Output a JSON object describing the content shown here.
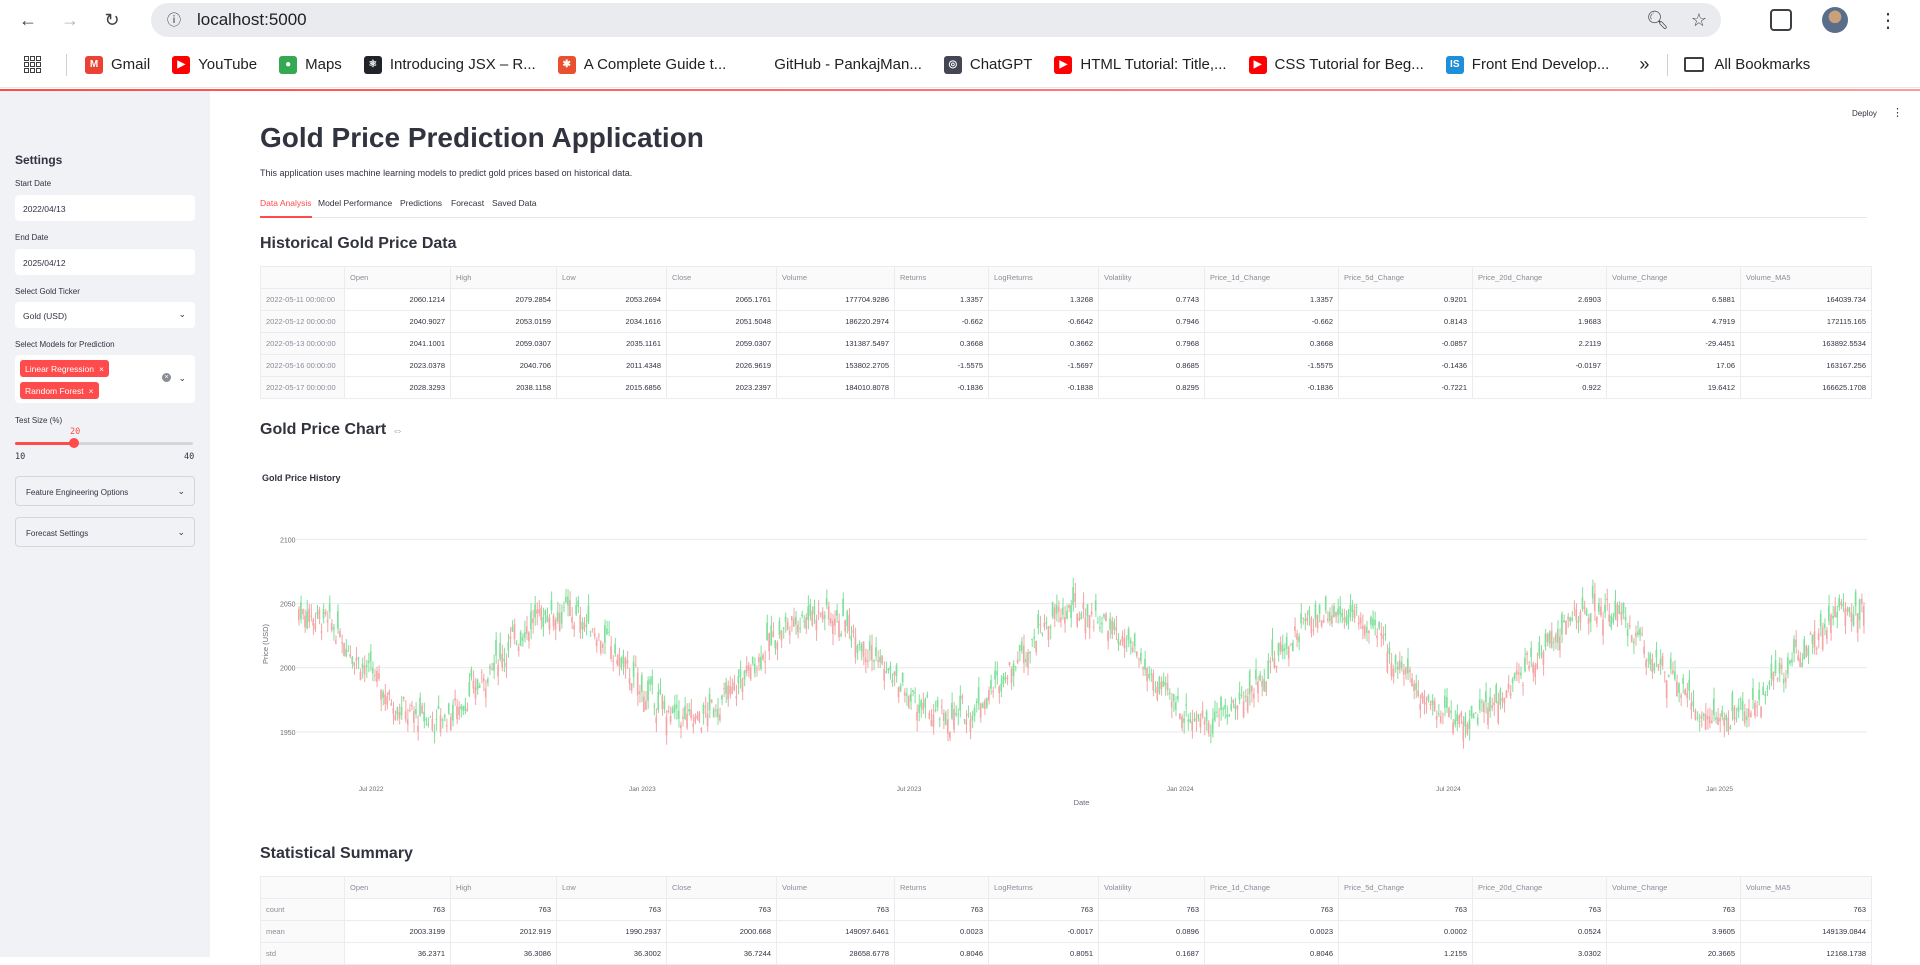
{
  "browser": {
    "url": "localhost:5000",
    "bookmarks": [
      {
        "label": "Gmail",
        "color": "#ea4335",
        "glyph": "M"
      },
      {
        "label": "YouTube",
        "color": "#ff0000",
        "glyph": "▶"
      },
      {
        "label": "Maps",
        "color": "#34a853",
        "glyph": "●"
      },
      {
        "label": "Introducing JSX – R...",
        "color": "#20232a",
        "glyph": "⚛"
      },
      {
        "label": "A Complete Guide t...",
        "color": "#e8502f",
        "glyph": "✱"
      },
      {
        "label": "GitHub - PankajMan...",
        "color": "#ffffff",
        "glyph": ""
      },
      {
        "label": "ChatGPT",
        "color": "#444654",
        "glyph": "◎"
      },
      {
        "label": "HTML Tutorial: Title,...",
        "color": "#ff0000",
        "glyph": "▶"
      },
      {
        "label": "CSS Tutorial for Beg...",
        "color": "#ff0000",
        "glyph": "▶"
      },
      {
        "label": "Front End Develop...",
        "color": "#1e8fd8",
        "glyph": "IS"
      }
    ],
    "all_bookmarks": "All Bookmarks"
  },
  "sidebar": {
    "title": "Settings",
    "start_date_label": "Start Date",
    "start_date": "2022/04/13",
    "end_date_label": "End Date",
    "end_date": "2025/04/12",
    "ticker_label": "Select Gold Ticker",
    "ticker": "Gold (USD)",
    "models_label": "Select Models for Prediction",
    "models": [
      "Linear Regression",
      "Random Forest"
    ],
    "test_size_label": "Test Size (%)",
    "test_size": "20",
    "test_size_min": "10",
    "test_size_max": "40",
    "test_size_fraction": 0.33,
    "expanders": [
      "Feature Engineering Options",
      "Forecast Settings"
    ]
  },
  "header": {
    "deploy": "Deploy"
  },
  "main": {
    "title": "Gold Price Prediction Application",
    "description": "This application uses machine learning models to predict gold prices based on historical data.",
    "tabs": [
      "Data Analysis",
      "Model Performance",
      "Predictions",
      "Forecast",
      "Saved Data"
    ],
    "historical_heading": "Historical Gold Price Data",
    "chart_heading": "Gold Price Chart",
    "stats_heading": "Statistical Summary"
  },
  "historical_table": {
    "columns": [
      "",
      "Open",
      "High",
      "Low",
      "Close",
      "Volume",
      "Returns",
      "LogReturns",
      "Volatility",
      "Price_1d_Change",
      "Price_5d_Change",
      "Price_20d_Change",
      "Volume_Change",
      "Volume_MA5"
    ],
    "rows": [
      [
        "2022-05-11 00:00:00",
        "2060.1214",
        "2079.2854",
        "2053.2694",
        "2065.1761",
        "177704.9286",
        "1.3357",
        "1.3268",
        "0.7743",
        "1.3357",
        "0.9201",
        "2.6903",
        "6.5881",
        "164039.734"
      ],
      [
        "2022-05-12 00:00:00",
        "2040.9027",
        "2053.0159",
        "2034.1616",
        "2051.5048",
        "186220.2974",
        "-0.662",
        "-0.6642",
        "0.7946",
        "-0.662",
        "0.8143",
        "1.9683",
        "4.7919",
        "172115.165"
      ],
      [
        "2022-05-13 00:00:00",
        "2041.1001",
        "2059.0307",
        "2035.1161",
        "2059.0307",
        "131387.5497",
        "0.3668",
        "0.3662",
        "0.7968",
        "0.3668",
        "-0.0857",
        "2.2119",
        "-29.4451",
        "163892.5534"
      ],
      [
        "2022-05-16 00:00:00",
        "2023.0378",
        "2040.706",
        "2011.4348",
        "2026.9619",
        "153802.2705",
        "-1.5575",
        "-1.5697",
        "0.8685",
        "-1.5575",
        "-0.1436",
        "-0.0197",
        "17.06",
        "163167.256"
      ],
      [
        "2022-05-17 00:00:00",
        "2028.3293",
        "2038.1158",
        "2015.6856",
        "2023.2397",
        "184010.8078",
        "-0.1836",
        "-0.1838",
        "0.8295",
        "-0.1836",
        "-0.7221",
        "0.922",
        "19.6412",
        "166625.1708"
      ]
    ]
  },
  "stats_table": {
    "columns": [
      "",
      "Open",
      "High",
      "Low",
      "Close",
      "Volume",
      "Returns",
      "LogReturns",
      "Volatility",
      "Price_1d_Change",
      "Price_5d_Change",
      "Price_20d_Change",
      "Volume_Change",
      "Volume_MA5"
    ],
    "rows": [
      [
        "count",
        "763",
        "763",
        "763",
        "763",
        "763",
        "763",
        "763",
        "763",
        "763",
        "763",
        "763",
        "763",
        "763"
      ],
      [
        "mean",
        "2003.3199",
        "2012.919",
        "1990.2937",
        "2000.668",
        "149097.6461",
        "0.0023",
        "-0.0017",
        "0.0896",
        "0.0023",
        "0.0002",
        "0.0524",
        "3.9605",
        "149139.0844"
      ],
      [
        "std",
        "36.2371",
        "36.3086",
        "36.3002",
        "36.7244",
        "28658.6778",
        "0.8046",
        "0.8051",
        "0.1687",
        "0.8046",
        "1.2155",
        "3.0302",
        "20.3665",
        "12168.1738"
      ]
    ]
  },
  "chart_data": {
    "type": "candlestick",
    "title": "Gold Price History",
    "xlabel": "Date",
    "ylabel": "Price (USD)",
    "ylim": [
      1925,
      2112
    ],
    "yticks": [
      "1950",
      "2000",
      "2050",
      "2100"
    ],
    "xticks": [
      "Jul 2022",
      "Jan 2023",
      "Jul 2023",
      "Jan 2024",
      "Jul 2024",
      "Jan 2025"
    ],
    "xrange": [
      "2022-05-11",
      "2025-04-11"
    ],
    "pattern": {
      "center": 2002,
      "amplitude": 42,
      "cycle_days": 126,
      "bars": 763
    },
    "colors": {
      "up": "#7fe09a",
      "down": "#f4a6a6",
      "grid": "#e9e9ec"
    }
  },
  "colors": {
    "accent": "#ff4b4b",
    "sidebar_bg": "#f0f2f6",
    "text": "#31333f"
  }
}
